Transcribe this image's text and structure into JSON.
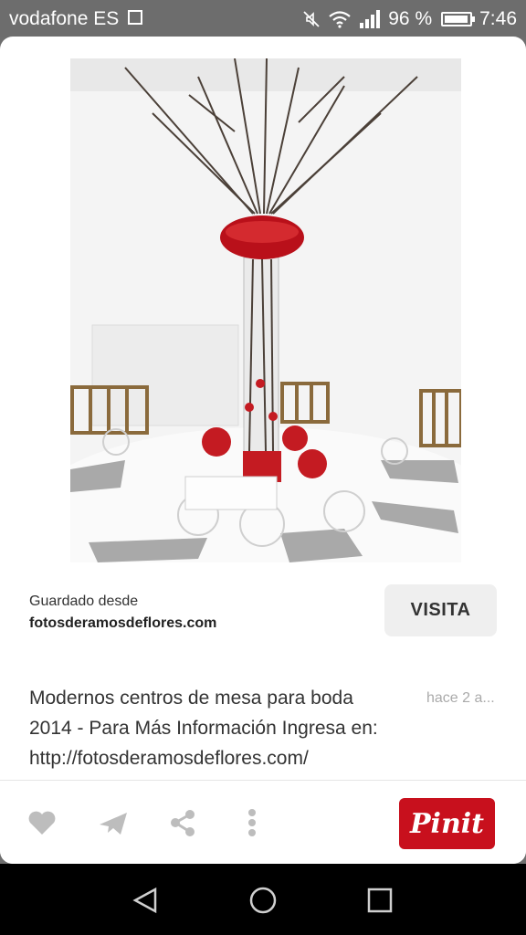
{
  "status_bar": {
    "carrier": "vodafone ES",
    "battery_percent": "96 %",
    "battery_level": 0.96,
    "time": "7:46",
    "icons": [
      "sim-icon",
      "mute-icon",
      "wifi-icon",
      "signal-icon",
      "battery-icon"
    ]
  },
  "pin": {
    "saved_from_label": "Guardado desde",
    "source_domain": "fotosderamosdeflores.com",
    "visit_label": "VISITA",
    "description": "Modernos centros de mesa para boda 2014 - Para Más Información Ingresa en: http://fotosderamosdeflores.com/ modernos-centros-de-mesa-para-",
    "timestamp": "hace 2 a..."
  },
  "actions": {
    "icons": [
      "heart-icon",
      "send-icon",
      "share-icon",
      "more-vertical-icon"
    ],
    "pin_it_label": "Pinit"
  },
  "colors": {
    "pin_it": "#c8101d",
    "status_bar": "#6d6d6d"
  },
  "nav": {
    "icons": [
      "back-icon",
      "home-icon",
      "recents-icon"
    ]
  }
}
